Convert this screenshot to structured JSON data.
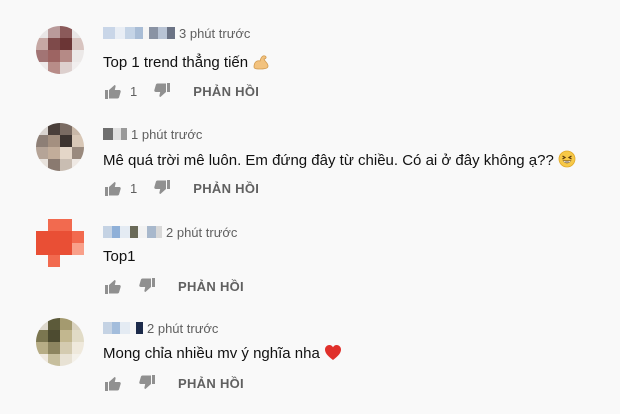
{
  "comments": [
    {
      "time": "3 phút trước",
      "text": "Top 1 trend thẳng tiến",
      "emoji": "flexed-biceps-emoji",
      "likes": "1",
      "reply_label": "PHẢN HỒI",
      "avatar_colors": [
        "#e9e6e6",
        "#b99a9a",
        "#8b5a5a",
        "#e9e6e6",
        "#c6a8a4",
        "#7e4a4a",
        "#6b3535",
        "#d8c4c0",
        "#a27474",
        "#9d6462",
        "#b58a86",
        "#ece9e8",
        "#eeeaea",
        "#b88c88",
        "#ddd0ce",
        "#f1eeee"
      ]
    },
    {
      "time": "1 phút trước",
      "text": "Mê quá trời mê luôn. Em đứng đây từ chiều. Có ai ở đây không ạ??",
      "emoji": "grinning-squinting-face-emoji",
      "likes": "1",
      "reply_label": "PHẢN HỒI",
      "avatar_colors": [
        "#d9d4d0",
        "#4a3f3a",
        "#7a6b62",
        "#c9b8a8",
        "#8d7f76",
        "#a49080",
        "#3d3430",
        "#d8c7b6",
        "#b5a497",
        "#c2ad9a",
        "#e4d6c8",
        "#9a8a7e",
        "#e8e2dc",
        "#8a7a70",
        "#c9bdb2",
        "#efe9e4"
      ]
    },
    {
      "time": "2 phút trước",
      "text": "Top1",
      "emoji": "",
      "likes": "",
      "reply_label": "PHẢN HỒI",
      "avatar_colors": [
        "#f9f9f9",
        "#f26a4f",
        "#f26a4f",
        "#f9f9f9",
        "#e94f35",
        "#e94f35",
        "#e94f35",
        "#f26a4f",
        "#e94f35",
        "#e94f35",
        "#e94f35",
        "#f9a08a",
        "#f9f9f9",
        "#f26a4f",
        "#f9f9f9",
        "#f9f9f9"
      ]
    },
    {
      "time": "2 phút trước",
      "text": "Mong chỉa nhiều mv ý nghĩa nha",
      "emoji": "red-heart-emoji",
      "likes": "",
      "reply_label": "PHẢN HỒI",
      "avatar_colors": [
        "#ddd8cc",
        "#5c5a3a",
        "#a49a6f",
        "#d9d2bf",
        "#7b7650",
        "#4d4b30",
        "#c2b78f",
        "#e1dbc6",
        "#b7ad86",
        "#8d8560",
        "#d4cbb0",
        "#efe9dc",
        "#efe9e0",
        "#c7bf9e",
        "#e8e2d4",
        "#f4f1ea"
      ]
    }
  ],
  "colors": {
    "meta": "#606060",
    "text": "#111111",
    "background": "#f9f9f9",
    "heart": "#e0302b"
  }
}
